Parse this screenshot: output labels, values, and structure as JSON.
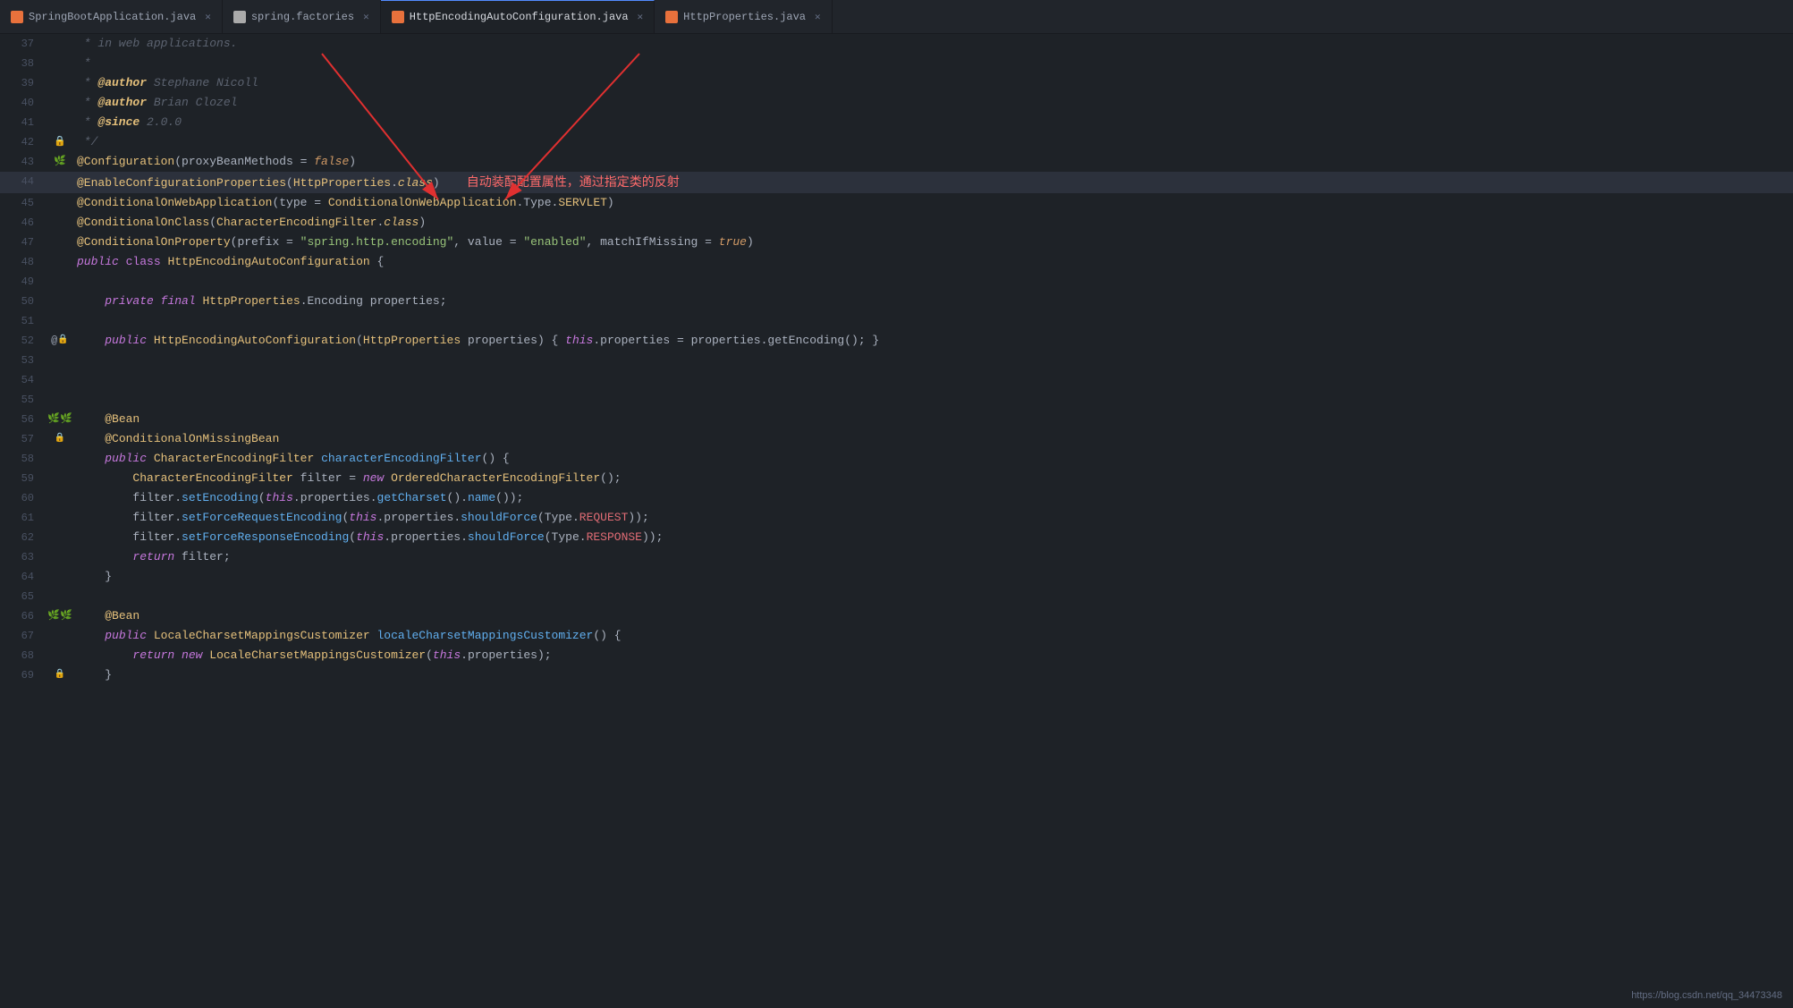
{
  "tabs": [
    {
      "id": "tab1",
      "label": "SpringBootApplication.java",
      "type": "java",
      "active": false
    },
    {
      "id": "tab2",
      "label": "spring.factories",
      "type": "factories",
      "active": false
    },
    {
      "id": "tab3",
      "label": "HttpEncodingAutoConfiguration.java",
      "type": "java",
      "active": true
    },
    {
      "id": "tab4",
      "label": "HttpProperties.java",
      "type": "java",
      "active": false
    }
  ],
  "lines": [
    {
      "num": 37,
      "gutter": "",
      "content": "comment_in_web"
    },
    {
      "num": 38,
      "gutter": "",
      "content": "comment_star"
    },
    {
      "num": 39,
      "gutter": "",
      "content": "comment_author1"
    },
    {
      "num": 40,
      "gutter": "",
      "content": "comment_author2"
    },
    {
      "num": 41,
      "gutter": "",
      "content": "comment_since"
    },
    {
      "num": 42,
      "gutter": "lock",
      "content": "comment_end"
    },
    {
      "num": 43,
      "gutter": "green",
      "content": "annotation_config"
    },
    {
      "num": 44,
      "gutter": "",
      "content": "annotation_enable_config"
    },
    {
      "num": 45,
      "gutter": "",
      "content": "annotation_conditional_web"
    },
    {
      "num": 46,
      "gutter": "",
      "content": "annotation_conditional_class"
    },
    {
      "num": 47,
      "gutter": "",
      "content": "annotation_conditional_property"
    },
    {
      "num": 48,
      "gutter": "",
      "content": "class_declaration"
    },
    {
      "num": 49,
      "gutter": "",
      "content": "empty"
    },
    {
      "num": 50,
      "gutter": "",
      "content": "private_field"
    },
    {
      "num": 51,
      "gutter": "",
      "content": "empty"
    },
    {
      "num": 52,
      "gutter": "at_lock",
      "content": "constructor"
    },
    {
      "num": 53,
      "gutter": "",
      "content": "empty"
    },
    {
      "num": 54,
      "gutter": "",
      "content": "empty"
    },
    {
      "num": 55,
      "gutter": "",
      "content": "empty"
    },
    {
      "num": 56,
      "gutter": "green2",
      "content": "bean_annotation"
    },
    {
      "num": 57,
      "gutter": "lock2",
      "content": "conditional_missing"
    },
    {
      "num": 58,
      "gutter": "",
      "content": "method_char_filter"
    },
    {
      "num": 59,
      "gutter": "",
      "content": "filter_new"
    },
    {
      "num": 60,
      "gutter": "",
      "content": "filter_set_encoding"
    },
    {
      "num": 61,
      "gutter": "",
      "content": "filter_set_force_req"
    },
    {
      "num": 62,
      "gutter": "",
      "content": "filter_set_force_resp"
    },
    {
      "num": 63,
      "gutter": "",
      "content": "return_filter"
    },
    {
      "num": 64,
      "gutter": "",
      "content": "close_brace"
    },
    {
      "num": 65,
      "gutter": "",
      "content": "empty"
    },
    {
      "num": 66,
      "gutter": "green3",
      "content": "bean_annotation2"
    },
    {
      "num": 67,
      "gutter": "",
      "content": "method_locale"
    },
    {
      "num": 68,
      "gutter": "",
      "content": "return_locale"
    },
    {
      "num": 69,
      "gutter": "lock3",
      "content": "close_brace2"
    }
  ],
  "cn_text": "自动装配配置属性，通过指定类的反射",
  "watermark": "https://blog.csdn.net/qq_34473348"
}
